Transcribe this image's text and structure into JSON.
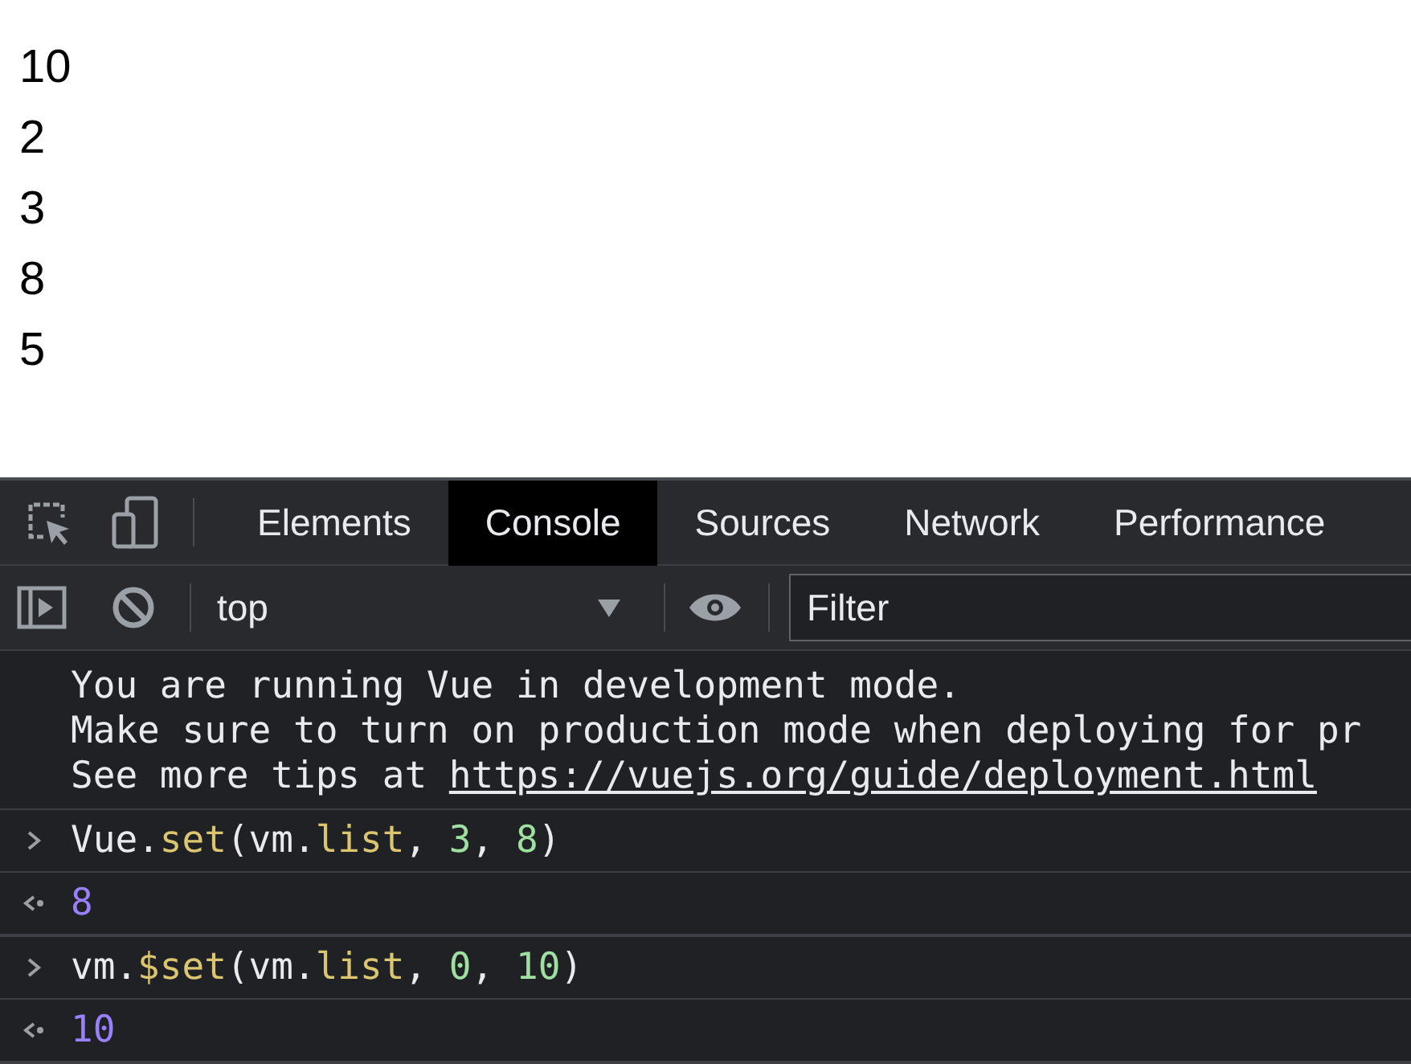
{
  "page": {
    "items": [
      "10",
      "2",
      "3",
      "8",
      "5"
    ]
  },
  "devtools": {
    "tabs": [
      {
        "label": "Elements",
        "selected": false
      },
      {
        "label": "Console",
        "selected": true
      },
      {
        "label": "Sources",
        "selected": false
      },
      {
        "label": "Network",
        "selected": false
      },
      {
        "label": "Performance",
        "selected": false
      }
    ],
    "context": "top",
    "filter": {
      "placeholder": "Filter"
    },
    "messages": [
      {
        "kind": "log",
        "lines": [
          {
            "text": "You are running Vue in development mode."
          },
          {
            "text": "Make sure to turn on production mode when deploying for pr"
          },
          {
            "text": "See more tips at ",
            "link": "https://vuejs.org/guide/deployment.html"
          }
        ]
      },
      {
        "kind": "input",
        "tokens": [
          {
            "kind": "plain",
            "text": "Vue."
          },
          {
            "kind": "property",
            "text": "set"
          },
          {
            "kind": "plain",
            "text": "(vm."
          },
          {
            "kind": "property",
            "text": "list"
          },
          {
            "kind": "plain",
            "text": ", "
          },
          {
            "kind": "number",
            "text": "3"
          },
          {
            "kind": "plain",
            "text": ", "
          },
          {
            "kind": "number",
            "text": "8"
          },
          {
            "kind": "plain",
            "text": ")"
          }
        ]
      },
      {
        "kind": "result",
        "text": "8"
      },
      {
        "kind": "input",
        "tokens": [
          {
            "kind": "plain",
            "text": "vm."
          },
          {
            "kind": "property",
            "text": "$set"
          },
          {
            "kind": "plain",
            "text": "(vm."
          },
          {
            "kind": "property",
            "text": "list"
          },
          {
            "kind": "plain",
            "text": ", "
          },
          {
            "kind": "number",
            "text": "0"
          },
          {
            "kind": "plain",
            "text": ", "
          },
          {
            "kind": "number",
            "text": "10"
          },
          {
            "kind": "plain",
            "text": ")"
          }
        ]
      },
      {
        "kind": "result",
        "text": "10"
      }
    ]
  }
}
